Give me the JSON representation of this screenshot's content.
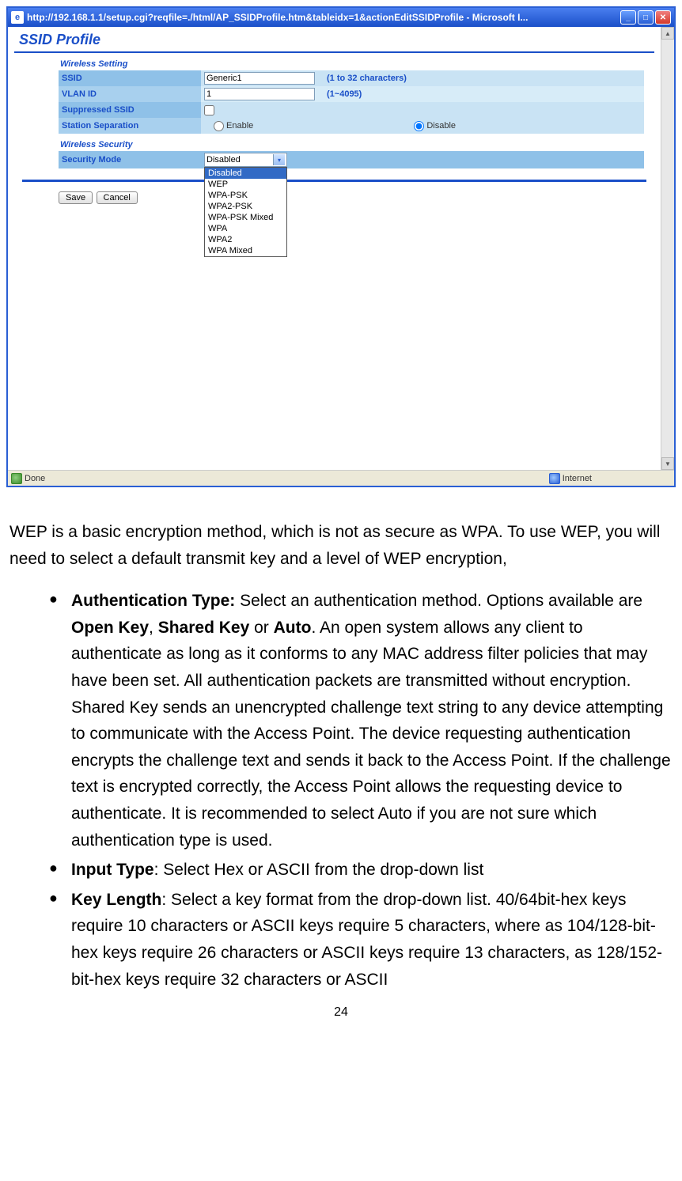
{
  "window_title": "http://192.168.1.1/setup.cgi?reqfile=./html/AP_SSIDProfile.htm&tableidx=1&actionEditSSIDProfile - Microsoft I...",
  "page_heading": "SSID Profile",
  "sections": {
    "wireless_setting": "Wireless Setting",
    "wireless_security": "Wireless Security"
  },
  "rows": {
    "ssid": {
      "label": "SSID",
      "value": "Generic1",
      "hint": "(1 to 32 characters)"
    },
    "vlan": {
      "label": "VLAN ID",
      "value": "1",
      "hint": "(1~4095)"
    },
    "suppressed": {
      "label": "Suppressed SSID"
    },
    "station_sep": {
      "label": "Station Separation",
      "enable": "Enable",
      "disable": "Disable"
    },
    "security_mode": {
      "label": "Security Mode",
      "selected": "Disabled"
    }
  },
  "security_mode_options": [
    "Disabled",
    "WEP",
    "WPA-PSK",
    "WPA2-PSK",
    "WPA-PSK Mixed",
    "WPA",
    "WPA2",
    "WPA Mixed"
  ],
  "buttons": {
    "save": "Save",
    "cancel": "Cancel"
  },
  "statusbar": {
    "left": "Done",
    "right": "Internet"
  },
  "doc": {
    "intro": "WEP is a basic encryption method, which is not as secure as WPA. To use WEP, you will need to select a default transmit key and a level of WEP encryption,",
    "bullets": {
      "auth_label": "Authentication Type:",
      "auth_text": " Select an authentication method. Options available are ",
      "auth_b1": "Open Key",
      "auth_sep1": ", ",
      "auth_b2": "Shared Key",
      "auth_sep2": " or ",
      "auth_b3": "Auto",
      "auth_tail": ". An open system allows any client to authenticate as long as it conforms to any MAC address filter policies that may have been set. All authentication packets are transmitted without encryption. Shared Key sends an unencrypted challenge text string to any device attempting to communicate with the Access Point. The device requesting authentication encrypts the challenge text and sends it back to the Access Point. If the challenge text is encrypted correctly, the Access Point allows the requesting device to authenticate. It is recommended to select Auto if you are not sure which authentication type is used.",
      "input_label": "Input Type",
      "input_text": ": Select Hex or ASCII from the drop-down list",
      "key_label": "Key Length",
      "key_text": ": Select a key format from the drop-down list. 40/64bit-hex keys require 10 characters or ASCII keys require 5 characters, where as 104/128-bit-hex keys require 26 characters or ASCII keys require 13 characters, as 128/152-bit-hex keys require 32 characters or ASCII"
    },
    "page_number": "24"
  }
}
